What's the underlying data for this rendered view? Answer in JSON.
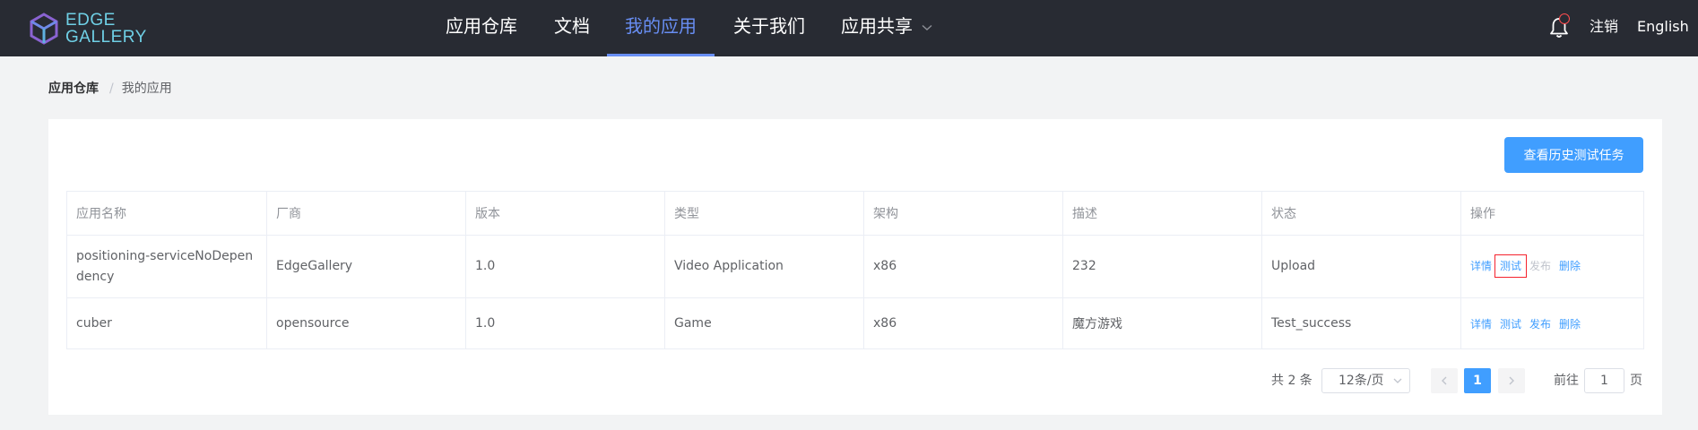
{
  "header": {
    "logo_line1": "EDGE",
    "logo_line2": "GALLERY",
    "nav": [
      "应用仓库",
      "文档",
      "我的应用",
      "关于我们",
      "应用共享"
    ],
    "active_nav": "我的应用",
    "logout": "注销",
    "language": "English",
    "icons": [
      "logo-cube-icon",
      "chevron-down-icon",
      "bell-icon"
    ]
  },
  "breadcrumb": {
    "root": "应用仓库",
    "separator": "/",
    "current": "我的应用"
  },
  "actions": {
    "history_button": "查看历史测试任务"
  },
  "table": {
    "columns": [
      "应用名称",
      "厂商",
      "版本",
      "类型",
      "架构",
      "描述",
      "状态",
      "操作"
    ],
    "rows": [
      {
        "name": "positioning-serviceNoDependency",
        "vendor": "EdgeGallery",
        "version": "1.0",
        "type": "Video Application",
        "arch": "x86",
        "desc": "232",
        "status": "Upload"
      },
      {
        "name": "cuber",
        "vendor": "opensource",
        "version": "1.0",
        "type": "Game",
        "arch": "x86",
        "desc": "魔方游戏",
        "status": "Test_success"
      }
    ],
    "ops": {
      "detail": "详情",
      "test": "测试",
      "publish": "发布",
      "delete": "删除"
    }
  },
  "pagination": {
    "total": "共 2 条",
    "page_size": "12条/页",
    "current_page": "1",
    "goto_label": "前往",
    "goto_value": "1",
    "page_suffix": "页"
  },
  "colors": {
    "nav_bg": "#282b33",
    "accent": "#409eff",
    "active_nav": "#688ef3",
    "highlight_box": "#f5222d"
  }
}
